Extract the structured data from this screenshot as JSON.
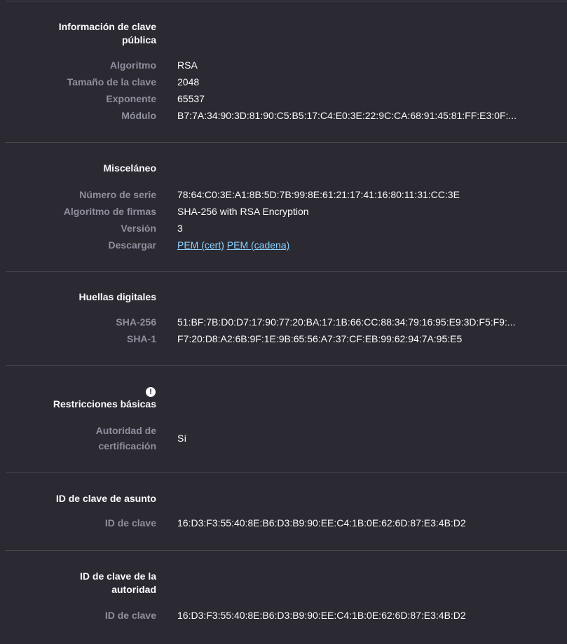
{
  "sections": {
    "public_key": {
      "title": "Información de clave pública",
      "title_line1": "Información de clave",
      "title_line2": "pública",
      "rows": [
        {
          "label": "Algoritmo",
          "value": "RSA"
        },
        {
          "label": "Tamaño de la clave",
          "value": "2048"
        },
        {
          "label": "Exponente",
          "value": "65537"
        },
        {
          "label": "Módulo",
          "value": "B7:7A:34:90:3D:81:90:C5:B5:17:C4:E0:3E:22:9C:CA:68:91:45:81:FF:E3:0F:..."
        }
      ]
    },
    "misc": {
      "title": "Misceláneo",
      "rows": [
        {
          "label": "Número de serie",
          "value": "78:64:C0:3E:A1:8B:5D:7B:99:8E:61:21:17:41:16:80:11:31:CC:3E"
        },
        {
          "label": "Algoritmo de firmas",
          "value": "SHA-256 with RSA Encryption"
        },
        {
          "label": "Versión",
          "value": "3"
        },
        {
          "label": "Descargar",
          "link1": "PEM (cert)",
          "link2": "PEM (cadena)"
        }
      ]
    },
    "fingerprints": {
      "title": "Huellas digitales",
      "rows": [
        {
          "label": "SHA-256",
          "value": "51:BF:7B:D0:D7:17:90:77:20:BA:17:1B:66:CC:88:34:79:16:95:E9:3D:F5:F9:..."
        },
        {
          "label": "SHA-1",
          "value": "F7:20:D8:A2:6B:9F:1E:9B:65:56:A7:37:CF:EB:99:62:94:7A:95:E5"
        }
      ]
    },
    "basic_constraints": {
      "title": "Restricciones básicas",
      "icon": "critical-icon",
      "icon_glyph": "!",
      "rows": [
        {
          "label": "Autoridad de certificación",
          "label_line1": "Autoridad de",
          "label_line2": "certificación",
          "value": "Sí"
        }
      ]
    },
    "subject_key_id": {
      "title": "ID de clave de asunto",
      "rows": [
        {
          "label": "ID de clave",
          "value": "16:D3:F3:55:40:8E:B6:D3:B9:90:EE:C4:1B:0E:62:6D:87:E3:4B:D2"
        }
      ]
    },
    "authority_key_id": {
      "title": "ID de clave de la autoridad",
      "title_line1": "ID de clave de la",
      "title_line2": "autoridad",
      "rows": [
        {
          "label": "ID de clave",
          "value": "16:D3:F3:55:40:8E:B6:D3:B9:90:EE:C4:1B:0E:62:6D:87:E3:4B:D2"
        }
      ]
    }
  },
  "colors": {
    "background": "#2b2a33",
    "label": "#8f8f9d",
    "text": "#fbfbfe",
    "link": "#8cd1ff",
    "divider": "#4a4950"
  }
}
